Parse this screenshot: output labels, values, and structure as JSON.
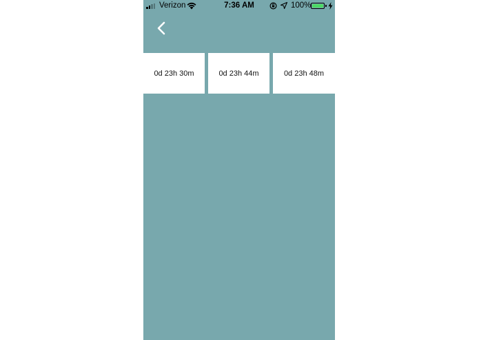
{
  "status_bar": {
    "carrier": "Verizon",
    "time": "7:36 AM",
    "battery_percent": "100%",
    "battery_level": 1.0,
    "signal_bars_on": 2,
    "signal_bars_total": 4,
    "icons": [
      "signal-icon",
      "wifi-icon",
      "rotation-lock-icon",
      "location-arrow-icon",
      "battery-icon",
      "charging-bolt-icon"
    ]
  },
  "nav": {
    "back_icon": "chevron-left-icon"
  },
  "timers": [
    {
      "label": "0d 23h 30m"
    },
    {
      "label": "0d 23h 44m"
    },
    {
      "label": "0d 23h 48m"
    }
  ],
  "colors": {
    "background": "#78a8ad",
    "card": "#ffffff",
    "battery_fill": "#4cd964"
  }
}
